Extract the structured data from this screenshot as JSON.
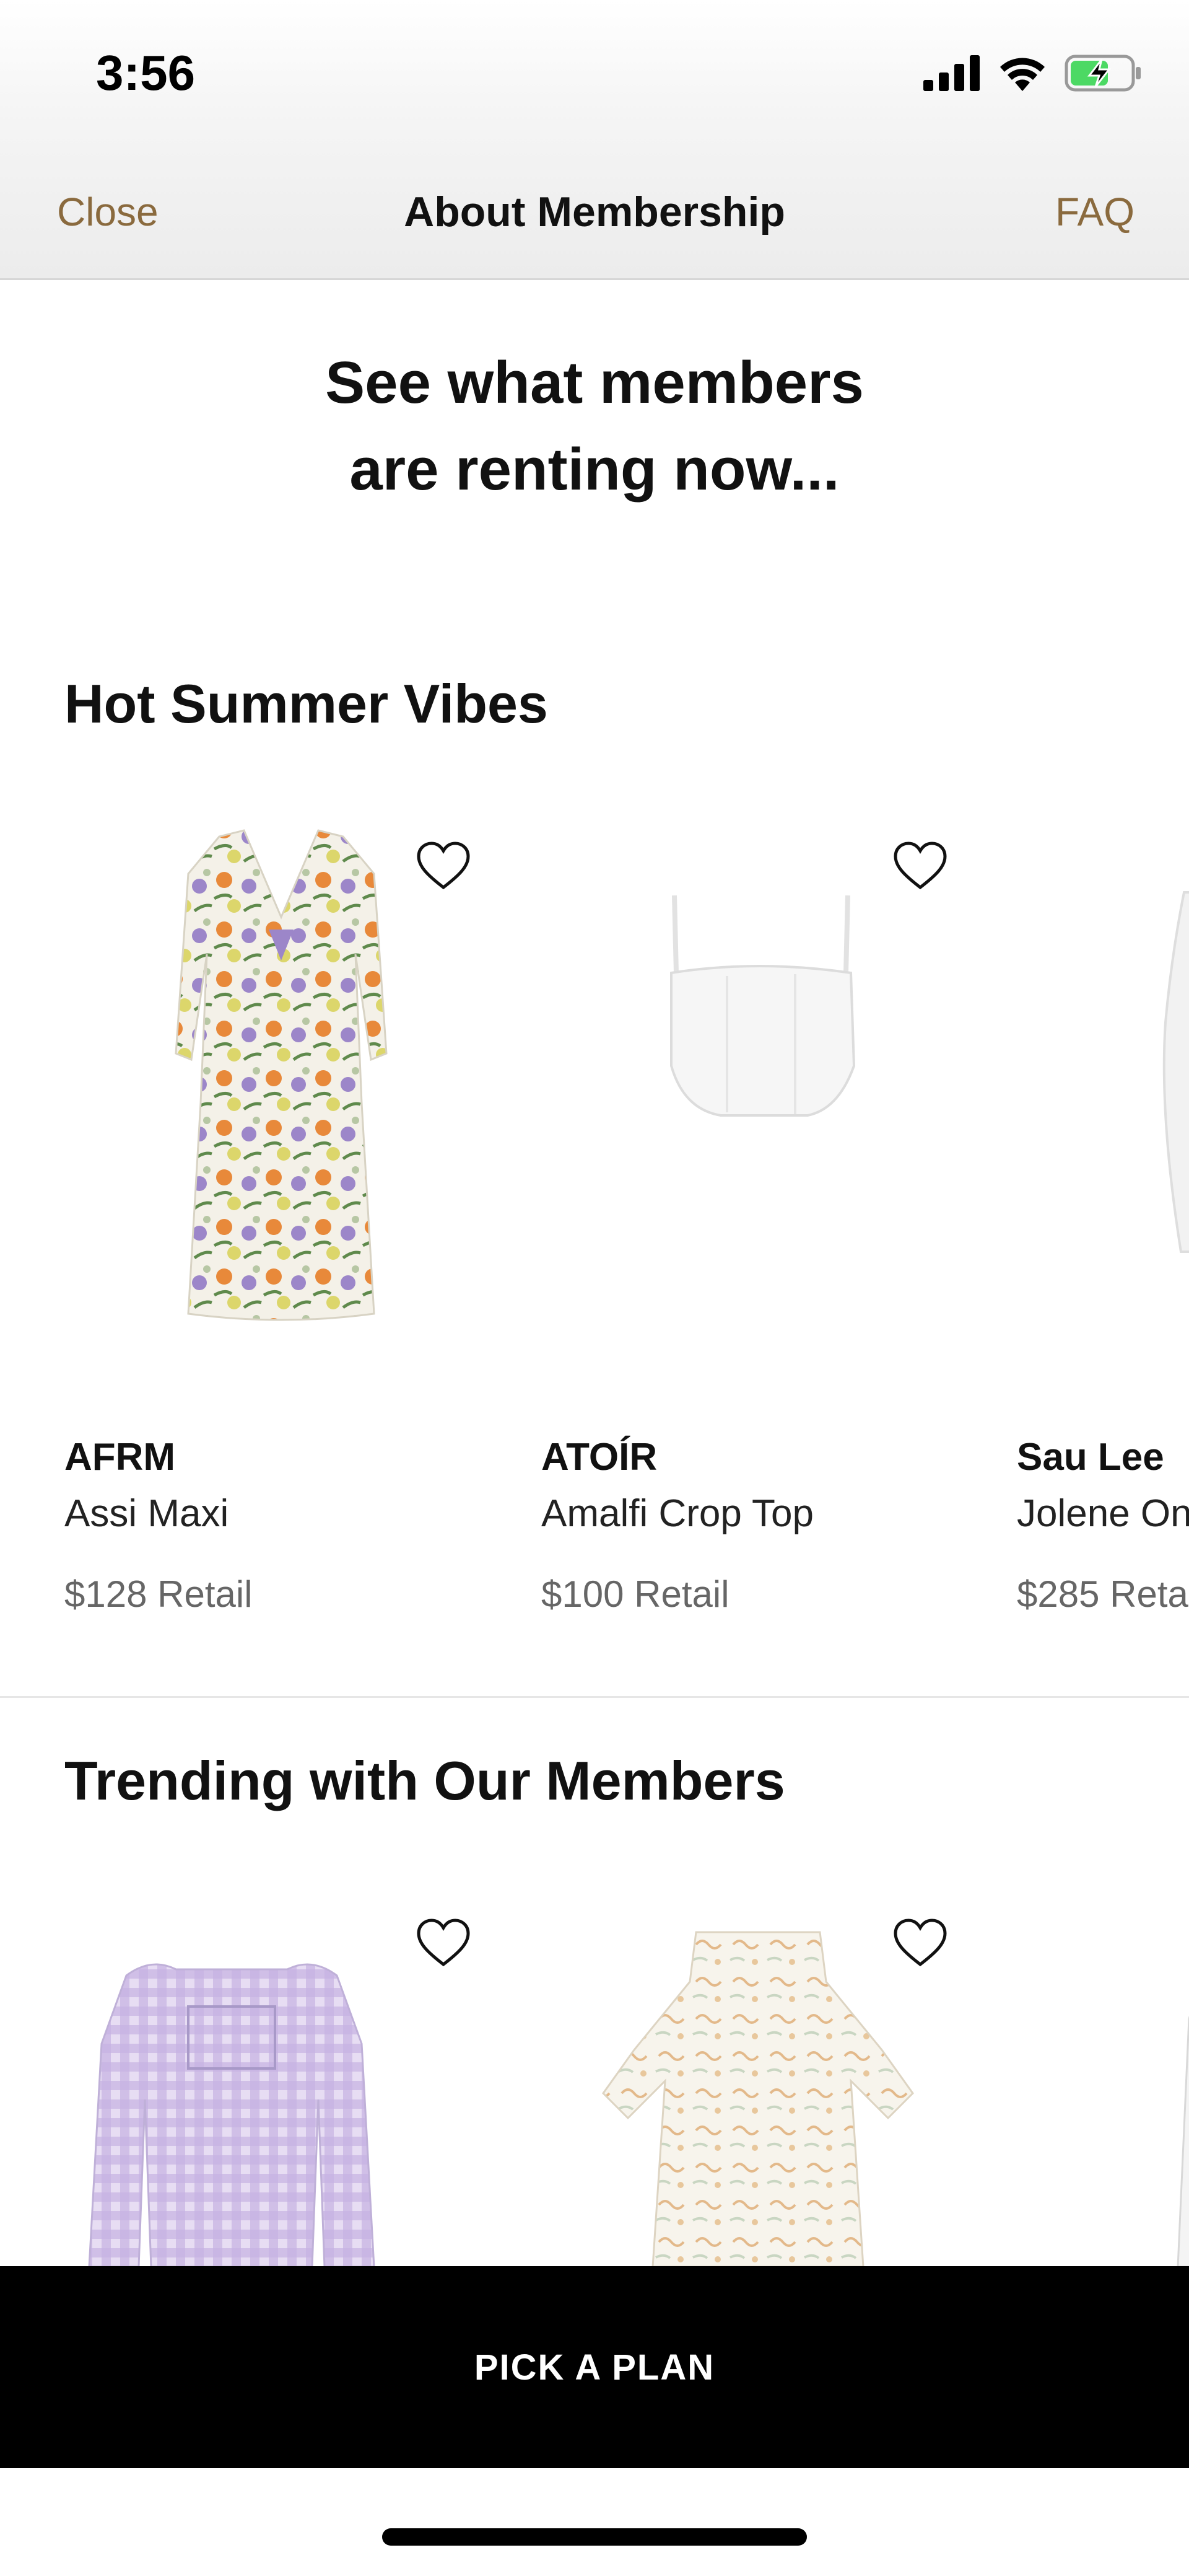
{
  "status_bar": {
    "time": "3:56"
  },
  "nav": {
    "close": "Close",
    "title": "About Membership",
    "faq": "FAQ"
  },
  "headline": {
    "line1": "See what members",
    "line2": "are renting now..."
  },
  "sections": [
    {
      "title": "Hot Summer Vibes",
      "items": [
        {
          "brand": "AFRM",
          "name": "Assi Maxi",
          "price": "$128 Retail"
        },
        {
          "brand": "ATOÍR",
          "name": "Amalfi Crop Top",
          "price": "$100 Retail"
        },
        {
          "brand": "Sau Lee",
          "name": "Jolene On",
          "price": "$285 Reta"
        }
      ]
    },
    {
      "title": "Trending with Our Members"
    }
  ],
  "cta": {
    "label": "PICK A PLAN"
  },
  "colors": {
    "accent": "#8a6a3e",
    "cta_bg": "#000000"
  },
  "icons": [
    "cellular-signal-icon",
    "wifi-icon",
    "battery-charging-icon",
    "heart-icon"
  ]
}
